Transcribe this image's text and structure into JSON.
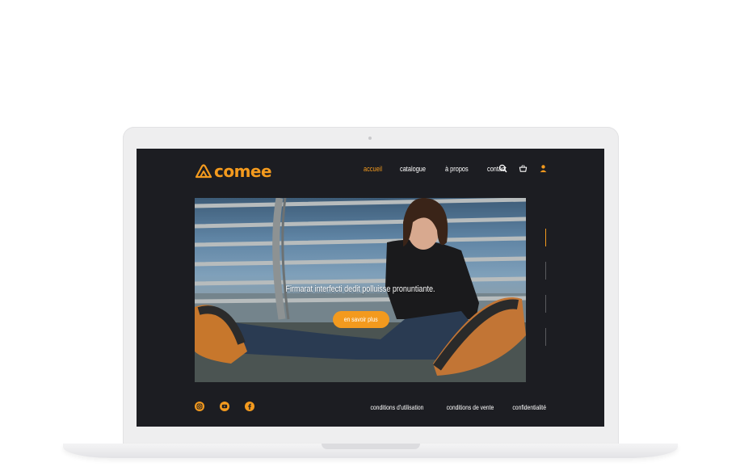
{
  "brand": {
    "name": "comee",
    "accent": "#f39a1e"
  },
  "nav": {
    "links": [
      "accueil",
      "catalogue",
      "à propos",
      "contact"
    ],
    "active": "accueil",
    "icons": [
      "search-icon",
      "basket-icon",
      "user-icon"
    ]
  },
  "hero": {
    "headline": "Firmarat interfecti dedit polluisse pronuntiante.",
    "cta_label": "en savoir plus",
    "slides": 4,
    "active_slide": 1
  },
  "footer": {
    "socials": [
      "instagram-icon",
      "youtube-icon",
      "facebook-icon"
    ],
    "links": [
      "conditions d'utilisation",
      "conditions de vente",
      "confidentialité"
    ]
  },
  "colors": {
    "background": "#1c1d22",
    "accent": "#f39a1e",
    "text": "#ffffff"
  }
}
